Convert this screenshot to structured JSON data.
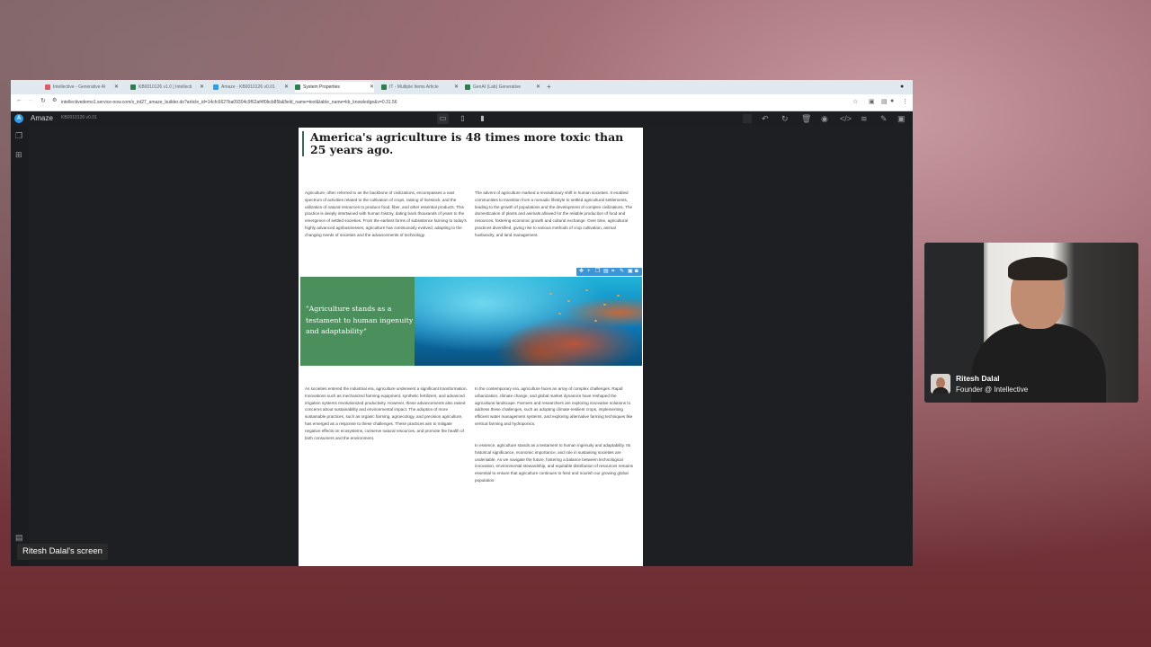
{
  "browser": {
    "tabs": [
      {
        "label": "Intellective - Generative AI",
        "color": "#e05a66"
      },
      {
        "label": "KB0010126 v1.0 | Intellecti",
        "color": "#2e7d4f"
      },
      {
        "label": "Amaze - KB0010126 v0.01",
        "color": "#2a9df4"
      },
      {
        "label": "System Properties",
        "color": "#2e7d4f"
      },
      {
        "label": "IT - Multiple Items Article",
        "color": "#2e7d4f"
      },
      {
        "label": "GenAI (Lab) Generative",
        "color": "#2e7d4f"
      }
    ],
    "active_tab_index": 2,
    "url": "intellectivedemo1.service-now.com/x_int27_amaze_builder.do?article_id=14cfc6627ba09304c9f62af4f0bcb85b&field_name=text&table_name=kb_knowledge&v=0.31.56"
  },
  "app": {
    "logo_letter": "A",
    "name": "Amaze",
    "version": "KB0010126 v0.01",
    "toolbar_icons": [
      "undo-icon",
      "redo-icon",
      "delete-icon",
      "preview-icon",
      "code-icon",
      "layers-icon",
      "attach-icon",
      "save-icon"
    ]
  },
  "document": {
    "headline": "America's agriculture is 48 times more toxic than 25 years ago.",
    "intro_left": "Agriculture, often referred to as the backbone of civilizations, encompasses a vast spectrum of activities related to the cultivation of crops, raising of livestock, and the utilization of natural resources to produce food, fiber, and other essential products. This practice is deeply intertwined with human history, dating back thousands of years to the emergence of settled societies. From the earliest forms of subsistence farming to today's highly advanced agribusinesses, agriculture has continuously evolved, adapting to the changing needs of societies and the advancements of technology.",
    "intro_right": "The advent of agriculture marked a revolutionary shift in human societies. It enabled communities to transition from a nomadic lifestyle to settled agricultural settlements, leading to the growth of populations and the development of complex civilizations. The domestication of plants and animals allowed for the reliable production of food and resources, fostering economic growth and cultural exchange. Over time, agricultural practices diversified, giving rise to various methods of crop cultivation, animal husbandry, and land management.",
    "quote": "\"Agriculture stands as a testament to human ingenuity and adaptability\"",
    "body_left": "As societies entered the industrial era, agriculture underwent a significant transformation. Innovations such as mechanized farming equipment, synthetic fertilizers, and advanced irrigation systems revolutionized productivity. However, these advancements also raised concerns about sustainability and environmental impact. The adoption of more sustainable practices, such as organic farming, agroecology, and precision agriculture, has emerged as a response to these challenges. These practices aim to mitigate negative effects on ecosystems, conserve natural resources, and promote the health of both consumers and the environment.",
    "body_right_1": "In the contemporary era, agriculture faces an array of complex challenges. Rapid urbanization, climate change, and global market dynamics have reshaped the agricultural landscape. Farmers and researchers are exploring innovative solutions to address these challenges, such as adopting climate-resilient crops, implementing efficient water management systems, and exploring alternative farming techniques like vertical farming and hydroponics.",
    "body_right_2": "In essence, agriculture stands as a testament to human ingenuity and adaptability. Its historical significance, economic importance, and role in sustaining societies are undeniable. As we navigate the future, fostering a balance between technological innovation, environmental stewardship, and equitable distribution of resources remains essential to ensure that agriculture continues to feed and nourish our growing global population."
  },
  "presenter": {
    "name": "Ritesh Dalal",
    "role": "Founder @ Intellective"
  },
  "screen_share_label": "Ritesh Dalal's screen"
}
